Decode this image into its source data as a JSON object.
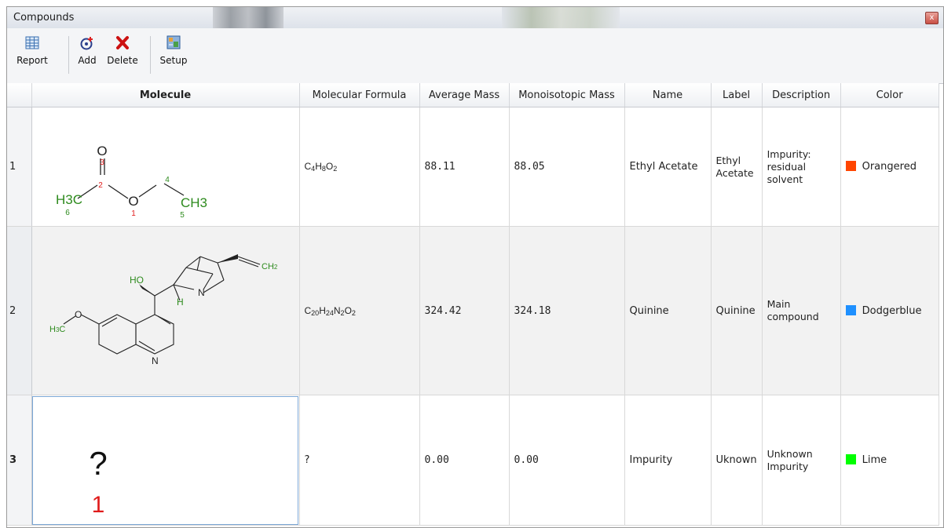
{
  "window": {
    "title": "Compounds",
    "close_glyph": "x"
  },
  "toolbar": {
    "report_label": "Report",
    "add_label": "Add",
    "delete_label": "Delete",
    "setup_label": "Setup"
  },
  "table": {
    "headers": {
      "molecule": "Molecule",
      "formula": "Molecular Formula",
      "avg_mass": "Average Mass",
      "mono_mass": "Monoisotopic Mass",
      "name": "Name",
      "label": "Label",
      "description": "Description",
      "color": "Color"
    },
    "rows": [
      {
        "num": "1",
        "formula": {
          "C": "4",
          "H": "8",
          "O": "2"
        },
        "avg_mass": "88.11",
        "mono_mass": "88.05",
        "name": "Ethyl Acetate",
        "label": "Ethyl Acetate",
        "description": "Impurity: residual solvent",
        "color_name": "Orangered",
        "color_hex": "#ff4500"
      },
      {
        "num": "2",
        "formula": {
          "C": "20",
          "H": "24",
          "N": "2",
          "O": "2"
        },
        "avg_mass": "324.42",
        "mono_mass": "324.18",
        "name": "Quinine",
        "label": "Quinine",
        "description": "Main compound",
        "color_name": "Dodgerblue",
        "color_hex": "#1e90ff"
      },
      {
        "num": "3",
        "formula_text": "?",
        "avg_mass": "0.00",
        "mono_mass": "0.00",
        "name": "Impurity",
        "label": "Uknown",
        "description": "Unknown Impurity",
        "color_name": "Lime",
        "color_hex": "#00ff00"
      }
    ]
  },
  "molecules": {
    "ethyl_acetate": {
      "O_top": "O",
      "O_ester": "O",
      "H3C": "H3C",
      "CH3": "CH3",
      "n1": "1",
      "n2": "2",
      "n3": "3",
      "n4": "4",
      "n5": "5",
      "n6": "6"
    },
    "unknown": {
      "symbol": "?",
      "index": "1"
    }
  },
  "colors": {
    "atom_green": "#2e8b1e",
    "atom_red": "#e01b1b",
    "selection_border": "#7ba7d6"
  }
}
